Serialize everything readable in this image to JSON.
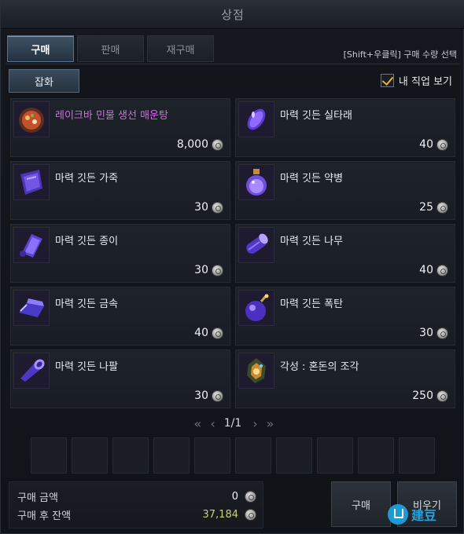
{
  "window": {
    "title": "상점"
  },
  "tabs": [
    {
      "label": "구매",
      "active": true
    },
    {
      "label": "판매",
      "active": false
    },
    {
      "label": "재구매",
      "active": false
    }
  ],
  "hint": "[Shift+우클릭] 구매 수량 선택",
  "category": {
    "label": "잡화"
  },
  "job_filter": {
    "label": "내 직업 보기",
    "checked": true
  },
  "items": [
    {
      "name": "레이크바 민물 생선 매운탕",
      "price": "8,000",
      "special": true,
      "icon": "spicy-fish-stew-icon"
    },
    {
      "name": "마력 깃든 실타래",
      "price": "40",
      "special": false,
      "icon": "magic-thread-spool-icon"
    },
    {
      "name": "마력 깃든 가죽",
      "price": "30",
      "special": false,
      "icon": "magic-leather-icon"
    },
    {
      "name": "마력 깃든 약병",
      "price": "25",
      "special": false,
      "icon": "magic-potion-bottle-icon"
    },
    {
      "name": "마력 깃든 종이",
      "price": "30",
      "special": false,
      "icon": "magic-paper-scroll-icon"
    },
    {
      "name": "마력 깃든 나무",
      "price": "40",
      "special": false,
      "icon": "magic-wood-log-icon"
    },
    {
      "name": "마력 깃든 금속",
      "price": "40",
      "special": false,
      "icon": "magic-metal-ingot-icon"
    },
    {
      "name": "마력 깃든 폭탄",
      "price": "30",
      "special": false,
      "icon": "magic-bomb-icon"
    },
    {
      "name": "마력 깃든 나팔",
      "price": "30",
      "special": false,
      "icon": "magic-horn-icon"
    },
    {
      "name": "각성 : 혼돈의 조각",
      "price": "250",
      "special": false,
      "icon": "chaos-fragment-icon"
    }
  ],
  "pager": {
    "page": "1/1"
  },
  "summary": {
    "purchase_label": "구매 금액",
    "purchase_value": "0",
    "balance_label": "구매 후 잔액",
    "balance_value": "37,184"
  },
  "buttons": {
    "buy": "구매",
    "clear": "비우기"
  },
  "watermark": {
    "text": "建豆"
  },
  "colors": {
    "accent": "#f1b32b",
    "special_name": "#d26ce6",
    "balance": "#c8d274"
  }
}
